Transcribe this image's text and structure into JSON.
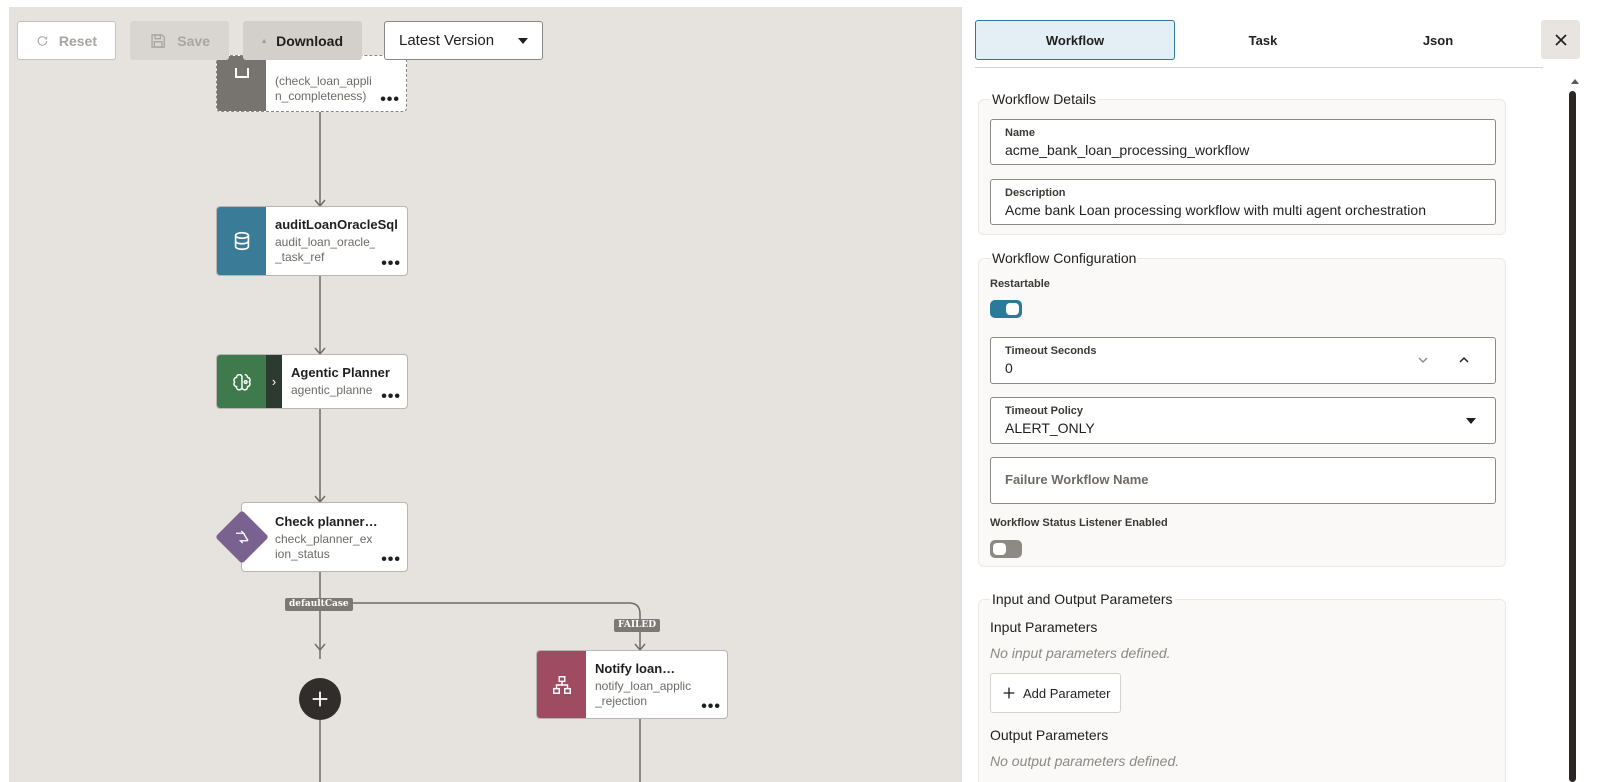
{
  "toolbar": {
    "reset_label": "Reset",
    "save_label": "Save",
    "download_label": "Download",
    "version_selected": "Latest Version"
  },
  "nodes": {
    "completeness": {
      "ref": "(check_loan_appli\nn_completeness)",
      "color": "#77736e"
    },
    "audit": {
      "title": "auditLoanOracleSql",
      "ref": "audit_loan_oracle_\n_task_ref",
      "color": "#3a7b97"
    },
    "planner": {
      "title": "Agentic Planner",
      "ref": "agentic_planne",
      "color": "#3e7a4b"
    },
    "check_status": {
      "title": "Check planner…",
      "ref": "check_planner_ex\nion_status",
      "color": "#7a6290"
    },
    "notify": {
      "title": "Notify loan…",
      "ref": "notify_loan_applic\n_rejection",
      "color": "#9f4c62"
    }
  },
  "edges": {
    "default_case": "defaultCase",
    "failed": "FAILED"
  },
  "panel": {
    "tabs": [
      "Workflow",
      "Task",
      "Json"
    ],
    "active_tab": "Workflow",
    "details": {
      "legend": "Workflow Details",
      "name_label": "Name",
      "name_value": "acme_bank_loan_processing_workflow",
      "description_label": "Description",
      "description_value": "Acme bank Loan processing workflow with multi agent orchestration"
    },
    "config": {
      "legend": "Workflow Configuration",
      "restartable_label": "Restartable",
      "restartable": true,
      "timeout_seconds_label": "Timeout Seconds",
      "timeout_seconds_value": "0",
      "timeout_policy_label": "Timeout Policy",
      "timeout_policy_value": "ALERT_ONLY",
      "failure_workflow_placeholder": "Failure Workflow Name",
      "status_listener_label": "Workflow Status Listener Enabled",
      "status_listener_enabled": false
    },
    "io": {
      "legend": "Input and Output Parameters",
      "input_heading": "Input Parameters",
      "input_empty": "No input parameters defined.",
      "add_parameter_label": "Add Parameter",
      "output_heading": "Output Parameters",
      "output_empty": "No output parameters defined."
    }
  },
  "colors": {
    "accent": "#2b7a99",
    "canvas_bg": "#e6e2dd"
  }
}
